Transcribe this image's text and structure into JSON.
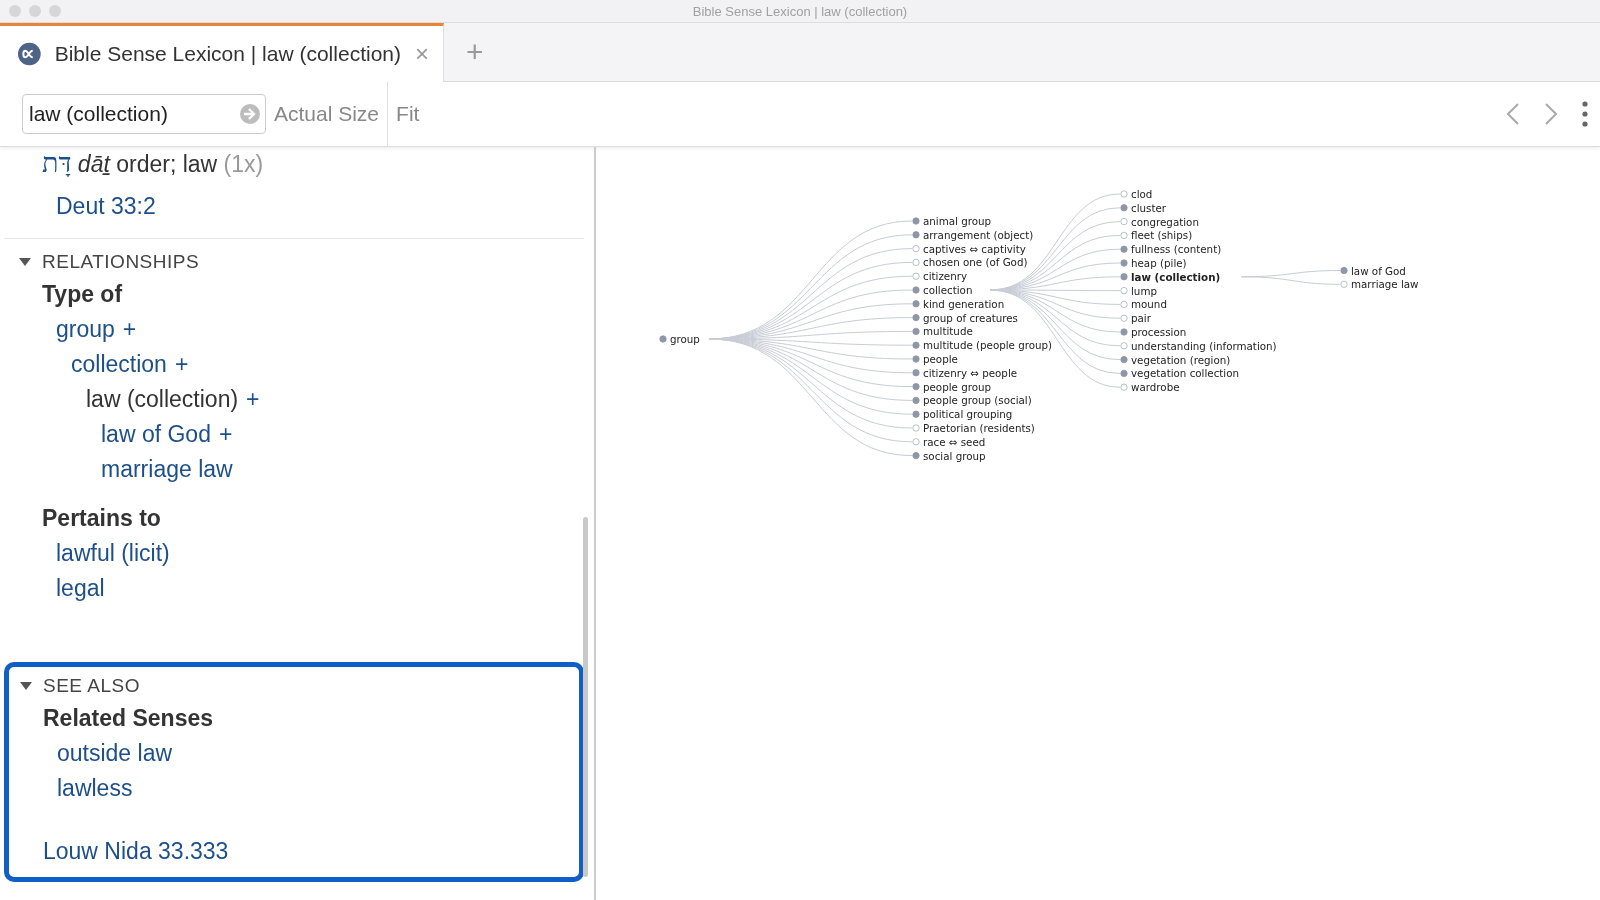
{
  "window": {
    "title": "Bible Sense Lexicon | law (collection)"
  },
  "tabs": [
    {
      "title": "Bible Sense Lexicon | law (collection)",
      "selected": true,
      "close": "×"
    }
  ],
  "new_tab": "+",
  "toolbar": {
    "search": {
      "value": "law (collection)"
    },
    "buttons": [
      "Actual Size",
      "Fit"
    ]
  },
  "lemma": {
    "hebrew": "דָּת",
    "transliteration": "dāṯ",
    "gloss": "order; law",
    "count": "(1x)",
    "reference": "Deut 33:2"
  },
  "sections": [
    {
      "title": "RELATIONSHIPS",
      "expanded": true,
      "highlighted": false,
      "groups": [
        {
          "heading": "Type of",
          "items": [
            {
              "label": "group",
              "current": false,
              "more": "+",
              "children": [
                {
                  "label": "collection",
                  "current": false,
                  "more": "+",
                  "children": [
                    {
                      "label": "law (collection)",
                      "current": true,
                      "more": "+",
                      "children": [
                        {
                          "label": "law of God",
                          "current": false,
                          "more": "+"
                        },
                        {
                          "label": "marriage law",
                          "current": false
                        }
                      ]
                    }
                  ]
                }
              ]
            }
          ]
        },
        {
          "heading": "Pertains to",
          "items": [
            {
              "label": "lawful (licit)",
              "current": false
            },
            {
              "label": "legal",
              "current": false
            }
          ]
        }
      ]
    },
    {
      "title": "SEE ALSO",
      "expanded": true,
      "highlighted": true,
      "groups": [
        {
          "heading": "Related Senses",
          "items": [
            {
              "label": "outside law",
              "current": false
            },
            {
              "label": "lawless",
              "current": false
            }
          ]
        }
      ],
      "link": "Louw Nida 33.333"
    }
  ],
  "diagram": {
    "tree": {
      "label": "group",
      "filled": true,
      "selected": false,
      "children": [
        {
          "label": "animal group",
          "filled": true,
          "selected": false
        },
        {
          "label": "arrangement (object)",
          "filled": true,
          "selected": false
        },
        {
          "label": "captives ⇔ captivity",
          "filled": false,
          "selected": false
        },
        {
          "label": "chosen one (of God)",
          "filled": false,
          "selected": false
        },
        {
          "label": "citizenry",
          "filled": false,
          "selected": false
        },
        {
          "label": "collection",
          "filled": true,
          "selected": false,
          "children": [
            {
              "label": "clod",
              "filled": false,
              "selected": false
            },
            {
              "label": "cluster",
              "filled": true,
              "selected": false
            },
            {
              "label": "congregation",
              "filled": false,
              "selected": false
            },
            {
              "label": "fleet (ships)",
              "filled": false,
              "selected": false
            },
            {
              "label": "fullness (content)",
              "filled": true,
              "selected": false
            },
            {
              "label": "heap (pile)",
              "filled": true,
              "selected": false
            },
            {
              "label": "law (collection)",
              "filled": true,
              "selected": true,
              "children": [
                {
                  "label": "law of God",
                  "filled": true,
                  "selected": false
                },
                {
                  "label": "marriage law",
                  "filled": false,
                  "selected": false
                }
              ]
            },
            {
              "label": "lump",
              "filled": false,
              "selected": false
            },
            {
              "label": "mound",
              "filled": false,
              "selected": false
            },
            {
              "label": "pair",
              "filled": false,
              "selected": false
            },
            {
              "label": "procession",
              "filled": true,
              "selected": false
            },
            {
              "label": "understanding (information)",
              "filled": false,
              "selected": false
            },
            {
              "label": "vegetation (region)",
              "filled": true,
              "selected": false
            },
            {
              "label": "vegetation collection",
              "filled": true,
              "selected": false
            },
            {
              "label": "wardrobe",
              "filled": false,
              "selected": false
            }
          ]
        },
        {
          "label": "kind generation",
          "filled": true,
          "selected": false
        },
        {
          "label": "group of creatures",
          "filled": true,
          "selected": false
        },
        {
          "label": "multitude",
          "filled": true,
          "selected": false
        },
        {
          "label": "multitude (people group)",
          "filled": true,
          "selected": false
        },
        {
          "label": "people",
          "filled": true,
          "selected": false
        },
        {
          "label": "citizenry ⇔ people",
          "filled": true,
          "selected": false
        },
        {
          "label": "people group",
          "filled": true,
          "selected": false
        },
        {
          "label": "people group (social)",
          "filled": true,
          "selected": false
        },
        {
          "label": "political grouping",
          "filled": true,
          "selected": false
        },
        {
          "label": "Praetorian (residents)",
          "filled": false,
          "selected": false
        },
        {
          "label": "race ⇔ seed",
          "filled": false,
          "selected": false
        },
        {
          "label": "social group",
          "filled": true,
          "selected": false
        }
      ]
    }
  }
}
